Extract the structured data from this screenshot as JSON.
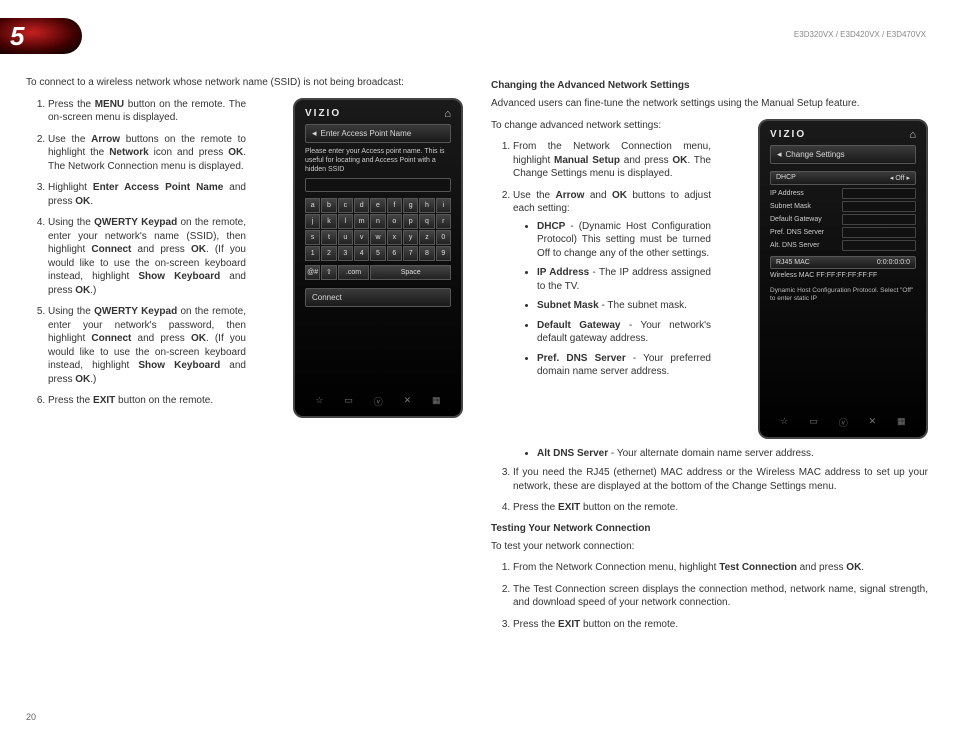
{
  "chapter": "5",
  "models": "E3D320VX / E3D420VX / E3D470VX",
  "pageNumber": "20",
  "left": {
    "intro": "To connect to a wireless network whose network name (SSID) is not being broadcast:",
    "s1a": "Press the ",
    "s1b": "MENU",
    "s1c": " button on the remote. The on-screen menu is displayed.",
    "s2a": "Use the ",
    "s2b": "Arrow",
    "s2c": " buttons on the remote to highlight the ",
    "s2d": "Network",
    "s2e": " icon and press ",
    "s2f": "OK",
    "s2g": ". The Network Connection menu is displayed.",
    "s3a": "Highlight ",
    "s3b": "Enter Access Point Name",
    "s3c": " and press ",
    "s3d": "OK",
    "s3e": ".",
    "s4a": "Using the ",
    "s4b": "QWERTY Keypad",
    "s4c": " on the remote, enter your network's name (SSID), then highlight ",
    "s4d": "Connect",
    "s4e": " and press ",
    "s4f": "OK",
    "s4g": ". (If you would like to use the on-screen keyboard instead, highlight ",
    "s4h": "Show Keyboard",
    "s4i": " and press ",
    "s4j": "OK",
    "s4k": ".)",
    "s5a": "Using the ",
    "s5b": "QWERTY Keypad",
    "s5c": " on the remote, enter your network's password, then highlight ",
    "s5d": "Connect",
    "s5e": " and press ",
    "s5f": "OK",
    "s5g": ". (If you would like to use the on-screen keyboard instead, highlight ",
    "s5h": "Show Keyboard",
    "s5i": " and press ",
    "s5j": "OK",
    "s5k": ".)",
    "s6a": "Press the ",
    "s6b": "EXIT",
    "s6c": " button on the remote.",
    "ph": {
      "brand": "VIZIO",
      "title": "Enter Access Point Name",
      "instr": "Please enter your Access point name. This is useful for locating and Access Point with a hidden SSID",
      "connect": "Connect",
      "keys": [
        "a",
        "b",
        "c",
        "d",
        "e",
        "f",
        "g",
        "h",
        "i",
        "j",
        "k",
        "l",
        "m",
        "n",
        "o",
        "p",
        "q",
        "r",
        "s",
        "t",
        "u",
        "v",
        "w",
        "x",
        "y",
        "z",
        "0",
        "1",
        "2",
        "3",
        "4",
        "5",
        "6",
        "7",
        "8",
        "9"
      ],
      "keys2": [
        "@#",
        "⇧",
        ".com",
        "Space",
        "⌫"
      ]
    }
  },
  "right": {
    "h1": "Changing the Advanced Network Settings",
    "p1": "Advanced users can fine-tune the network settings using the Manual Setup feature.",
    "p2": "To change advanced network settings:",
    "s1a": "From the Network Connection menu, highlight ",
    "s1b": "Manual Setup",
    "s1c": " and press ",
    "s1d": "OK",
    "s1e": ". The Change Settings menu is displayed.",
    "s2a": "Use the ",
    "s2b": "Arrow",
    "s2c": " and ",
    "s2d": "OK",
    "s2e": " buttons to adjust each setting:",
    "b1a": "DHCP",
    "b1b": " - (Dynamic Host Configuration Protocol) This setting must be turned Off to change any of the other settings.",
    "b2a": "IP Address",
    "b2b": " - The IP address assigned to the TV.",
    "b3a": "Subnet Mask",
    "b3b": " - The subnet mask.",
    "b4a": "Default Gateway",
    "b4b": " - Your network's default gateway address.",
    "b5a": "Pref. DNS Server",
    "b5b": " - Your preferred domain name server address.",
    "b6a": "Alt DNS Server",
    "b6b": " - Your alternate domain name server address.",
    "s3": "If you need the RJ45 (ethernet) MAC address or the Wireless MAC address to set up your network, these are displayed at the bottom of the Change Settings menu.",
    "s4a": "Press the ",
    "s4b": "EXIT",
    "s4c": " button on the remote.",
    "h2": "Testing Your Network Connection",
    "p3": "To test your network connection:",
    "t1a": "From the Network Connection menu, highlight ",
    "t1b": "Test Connection",
    "t1c": " and press ",
    "t1d": "OK",
    "t1e": ".",
    "t2": "The Test Connection screen displays the connection method, network name, signal strength, and download speed of your network connection.",
    "t3a": "Press the ",
    "t3b": "EXIT",
    "t3c": " button on the remote.",
    "ph": {
      "brand": "VIZIO",
      "title": "Change Settings",
      "dhcp": "DHCP",
      "off": "◂ Off ▸",
      "ip": "IP Address",
      "mask": "Subnet Mask",
      "gw": "Default Gateway",
      "dns1": "Pref. DNS Server",
      "dns2": "Alt. DNS Server",
      "rj45": "RJ45 MAC",
      "rj45v": "0:0:0:0:0:0",
      "wmac": "Wireless MAC   FF:FF:FF:FF:FF:FF",
      "hint": "Dynamic Host Configuration Protocol. Select \"Off\" to enter static IP"
    }
  }
}
